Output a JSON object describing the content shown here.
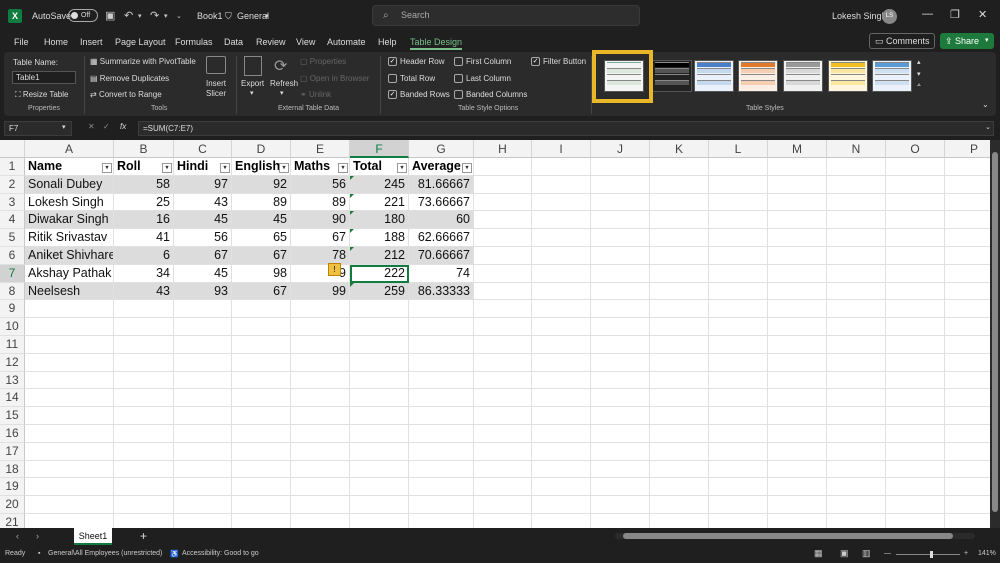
{
  "titlebar": {
    "logo": "X",
    "autosave_label": "AutoSave",
    "autosave_state": "Off",
    "book_name": "Book1",
    "sensitivity": "General",
    "search_placeholder": "Search",
    "user_name": "Lokesh Singh",
    "user_initials": "LS"
  },
  "menu": {
    "tabs": [
      "File",
      "Home",
      "Insert",
      "Page Layout",
      "Formulas",
      "Data",
      "Review",
      "View",
      "Automate",
      "Help",
      "Table Design"
    ],
    "active_tab": "Table Design",
    "comments_label": "Comments",
    "share_label": "Share"
  },
  "ribbon": {
    "table_name_label": "Table Name:",
    "table_name_value": "Table1",
    "resize_table": "Resize Table",
    "properties_group": "Properties",
    "summarize": "Summarize with PivotTable",
    "remove_duplicates": "Remove Duplicates",
    "convert_range": "Convert to Range",
    "tools_group": "Tools",
    "insert_slicer": [
      "Insert",
      "Slicer"
    ],
    "export": "Export",
    "refresh": "Refresh",
    "properties": "Properties",
    "open_in_browser": "Open in Browser",
    "unlink": "Unlink",
    "external_group": "External Table Data",
    "header_row": "Header Row",
    "total_row": "Total Row",
    "banded_rows": "Banded Rows",
    "first_column": "First Column",
    "last_column": "Last Column",
    "banded_columns": "Banded Columns",
    "filter_button": "Filter Button",
    "style_options_group": "Table Style Options",
    "table_styles_group": "Table Styles"
  },
  "formula_bar": {
    "name_box": "F7",
    "fx": "fx",
    "formula": "=SUM(C7:E7)"
  },
  "grid": {
    "columns": [
      "A",
      "B",
      "C",
      "D",
      "E",
      "F",
      "G",
      "H",
      "I",
      "J",
      "K",
      "L",
      "M",
      "N",
      "O",
      "P"
    ],
    "rows": [
      "1",
      "2",
      "3",
      "4",
      "5",
      "6",
      "7",
      "8",
      "9",
      "10",
      "11",
      "12",
      "13",
      "14",
      "15",
      "16",
      "17",
      "18",
      "19",
      "20",
      "21"
    ],
    "headers": [
      "Name",
      "Roll",
      "Hindi",
      "English",
      "Maths",
      "Total",
      "Average"
    ],
    "data": [
      [
        "Sonali Dubey",
        "58",
        "97",
        "92",
        "56",
        "245",
        "81.66667"
      ],
      [
        "Lokesh Singh",
        "25",
        "43",
        "89",
        "89",
        "221",
        "73.66667"
      ],
      [
        "Diwakar Singh",
        "16",
        "45",
        "45",
        "90",
        "180",
        "60"
      ],
      [
        "Ritik Srivastav",
        "41",
        "56",
        "65",
        "67",
        "188",
        "62.66667"
      ],
      [
        "Aniket Shivhare",
        "6",
        "67",
        "67",
        "78",
        "212",
        "70.66667"
      ],
      [
        "Akshay Pathak",
        "34",
        "45",
        "98",
        "9",
        "222",
        "74"
      ],
      [
        "Neelsesh",
        "43",
        "93",
        "67",
        "99",
        "259",
        "86.33333"
      ]
    ],
    "selected_cell": "F7"
  },
  "sheets": {
    "active": "Sheet1",
    "add": "+"
  },
  "status": {
    "ready": "Ready",
    "label": "General\\All Employees (unrestricted)",
    "accessibility": "Accessibility: Good to go",
    "zoom": "141%"
  }
}
